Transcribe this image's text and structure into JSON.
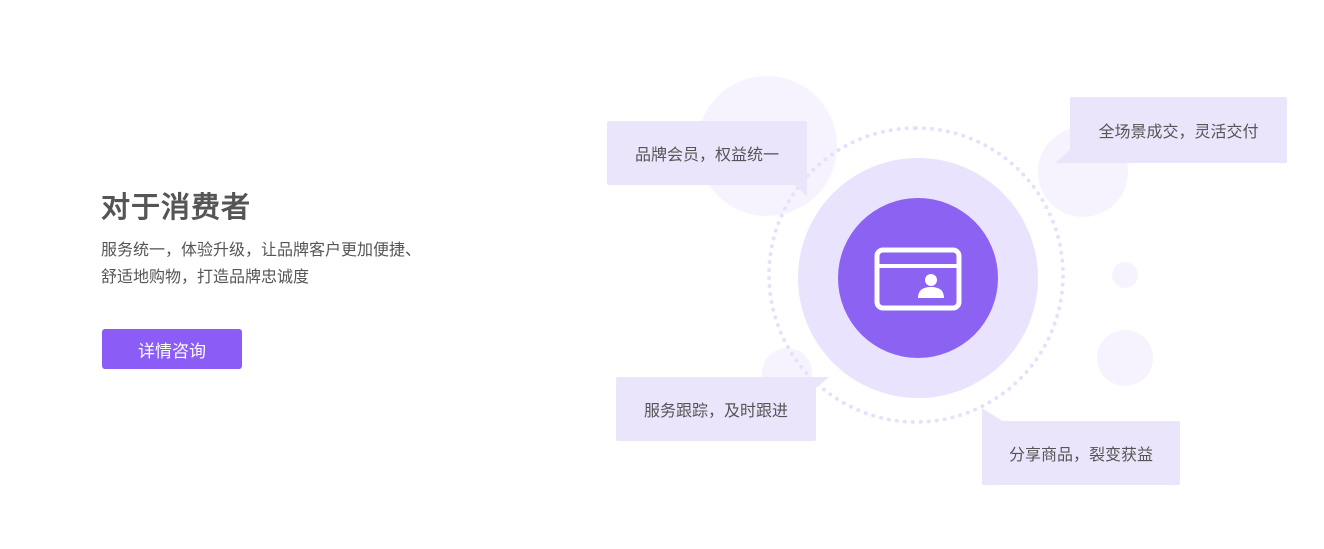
{
  "section": {
    "title": "对于消费者",
    "description_lines": [
      "服务统一，体验升级，让品牌客户更加便捷、",
      "舒适地购物，打造品牌忠诚度"
    ],
    "cta_label": "详情咨询"
  },
  "features": {
    "membership": "品牌会员，权益统一",
    "full_scene": "全场景成交，灵活交付",
    "service_tracking": "服务跟踪，及时跟进",
    "share_products": "分享商品，裂变获益"
  },
  "icons": {
    "center": "member-card-icon"
  },
  "colors": {
    "accent": "#8b5cf6",
    "bubble_bg": "#ebe5fc",
    "outer_circle": "#e9e3fd",
    "deco_circle": "#f6f3ff",
    "text": "#555555"
  }
}
